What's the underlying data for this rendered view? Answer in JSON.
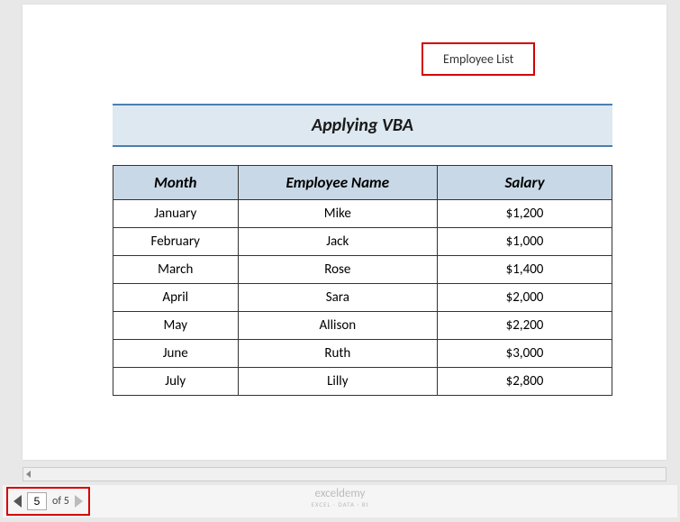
{
  "header": {
    "title": "Employee List"
  },
  "page_title": "Applying VBA",
  "table": {
    "headers": {
      "month": "Month",
      "name": "Employee Name",
      "salary": "Salary"
    },
    "rows": [
      {
        "month": "January",
        "name": "Mike",
        "salary": "$1,200"
      },
      {
        "month": "February",
        "name": "Jack",
        "salary": "$1,000"
      },
      {
        "month": "March",
        "name": "Rose",
        "salary": "$1,400"
      },
      {
        "month": "April",
        "name": "Sara",
        "salary": "$2,000"
      },
      {
        "month": "May",
        "name": "Allison",
        "salary": "$2,200"
      },
      {
        "month": "June",
        "name": "Ruth",
        "salary": "$3,000"
      },
      {
        "month": "July",
        "name": "Lilly",
        "salary": "$2,800"
      }
    ]
  },
  "pager": {
    "current": "5",
    "of_label": "of 5"
  },
  "watermark": {
    "main": "exceldemy",
    "sub": "EXCEL · DATA · BI"
  }
}
